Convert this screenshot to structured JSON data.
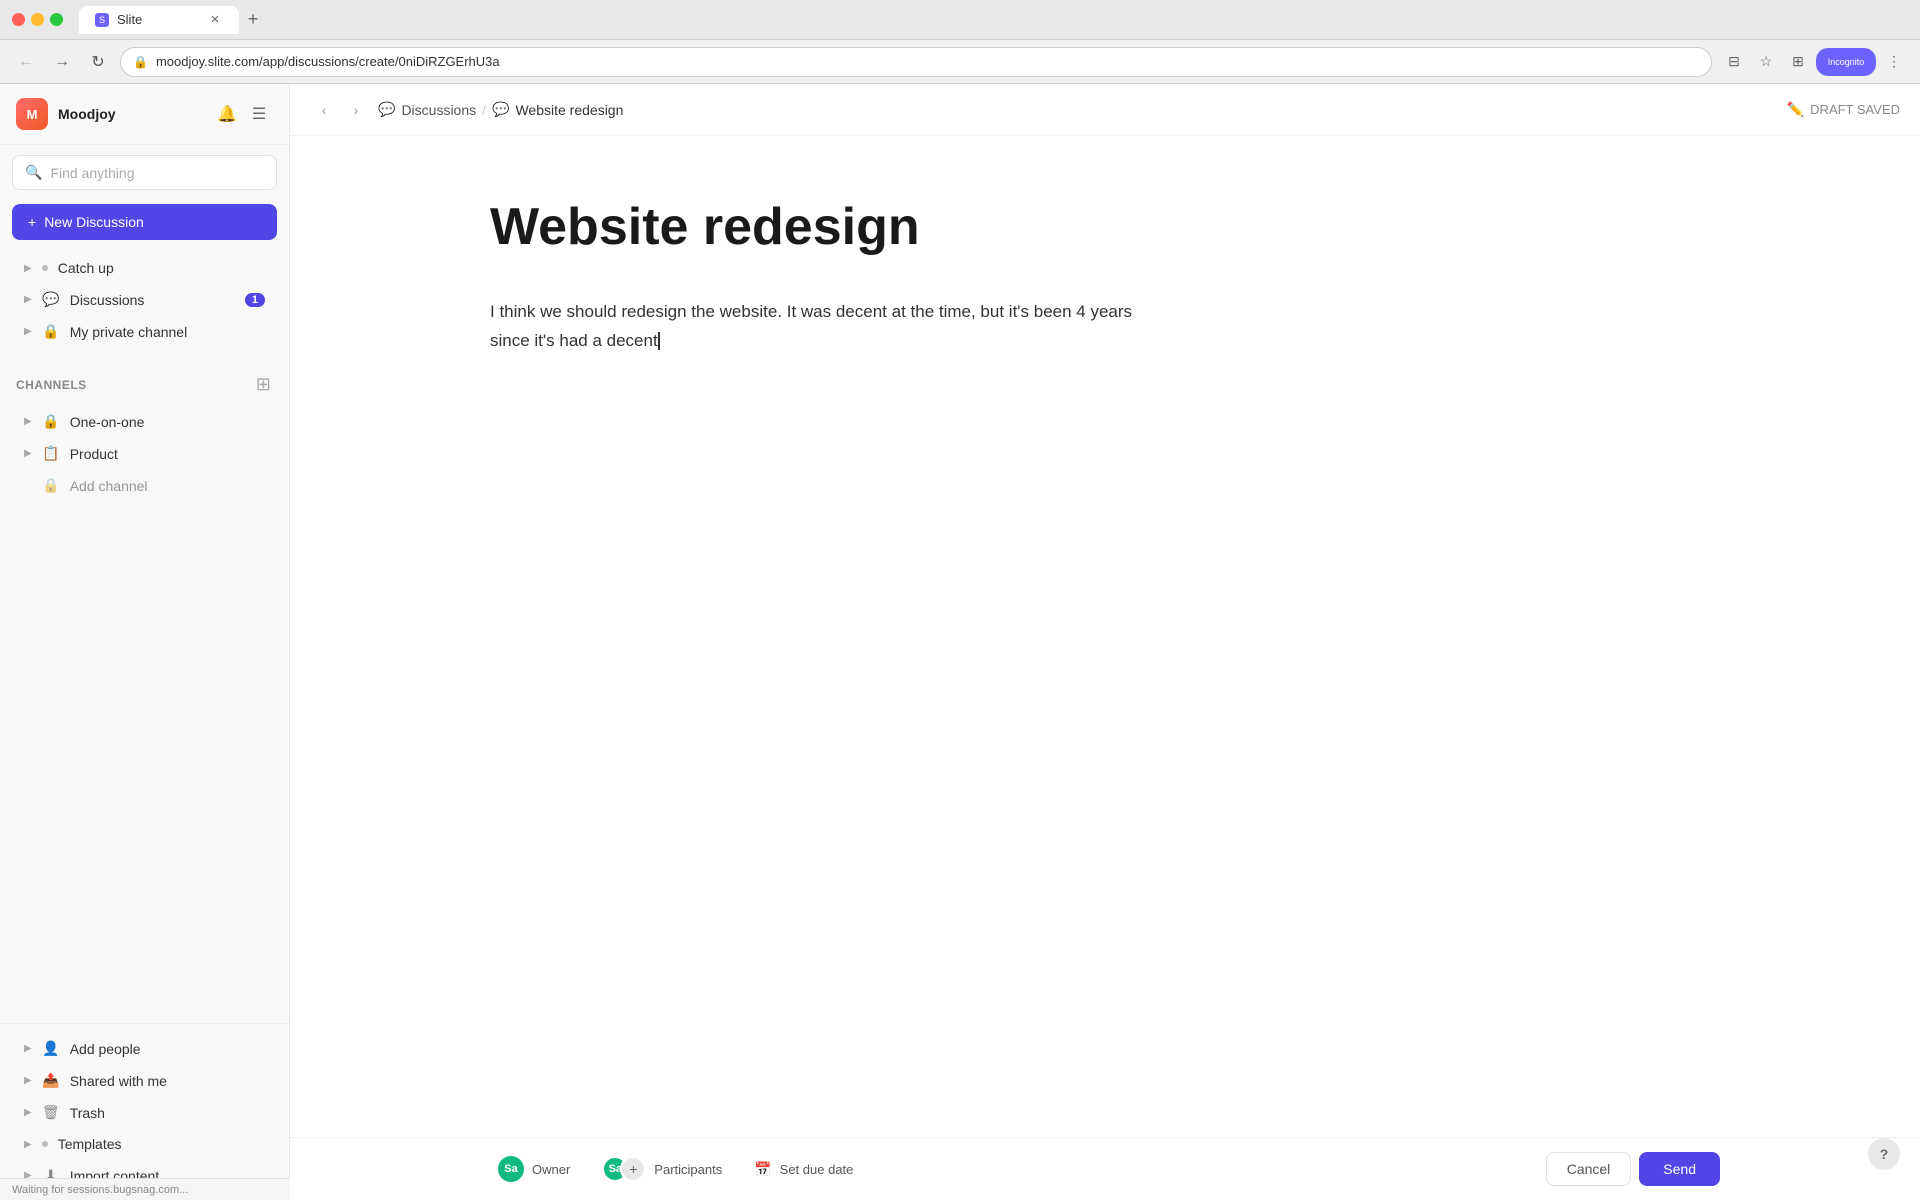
{
  "browser": {
    "tab_title": "Slite",
    "address": "moodjoy.slite.com/app/discussions/create/0niDiRZGErhU3a",
    "new_tab_label": "+",
    "back_btn": "←",
    "forward_btn": "→",
    "refresh_btn": "↻",
    "profile_label": "Incognito"
  },
  "sidebar": {
    "workspace_name": "Moodjoy",
    "search_placeholder": "Find anything",
    "new_discussion_label": "New Discussion",
    "nav_items": [
      {
        "id": "catch-up",
        "label": "Catch up",
        "icon": "●",
        "badge": null
      },
      {
        "id": "discussions",
        "label": "Discussions",
        "icon": "💬",
        "badge": "1"
      },
      {
        "id": "my-private-channel",
        "label": "My private channel",
        "icon": "🔒",
        "badge": null
      }
    ],
    "channels_label": "Channels",
    "channel_items": [
      {
        "id": "one-on-one",
        "label": "One-on-one",
        "icon": "🔒"
      },
      {
        "id": "product",
        "label": "Product",
        "icon": "📋"
      },
      {
        "id": "add-channel",
        "label": "Add channel",
        "icon": "🔒",
        "muted": true
      }
    ],
    "footer_items": [
      {
        "id": "add-people",
        "label": "Add people",
        "icon": "👤"
      },
      {
        "id": "shared-with-me",
        "label": "Shared with me",
        "icon": "📤"
      },
      {
        "id": "trash",
        "label": "Trash",
        "icon": "🗑"
      },
      {
        "id": "templates",
        "label": "Templates",
        "icon": "●"
      },
      {
        "id": "import-content",
        "label": "Import content",
        "icon": "⬇"
      }
    ]
  },
  "header": {
    "breadcrumb_discussions": "Discussions",
    "breadcrumb_current": "Website redesign",
    "draft_saved_label": "DRAFT SAVED"
  },
  "editor": {
    "title": "Website redesign",
    "body_line1": "I think we should redesign the website. It was decent at the time, but it's been 4 years",
    "body_line2": "since it's had a decent"
  },
  "bottom_bar": {
    "owner_label": "Owner",
    "participants_label": "Participants",
    "set_due_date_label": "Set due date",
    "cancel_label": "Cancel",
    "send_label": "Send",
    "owner_initials": "Sa",
    "participant_initials": "Sa"
  },
  "status_bar": {
    "text": "Waiting for sessions.bugsnag.com..."
  }
}
